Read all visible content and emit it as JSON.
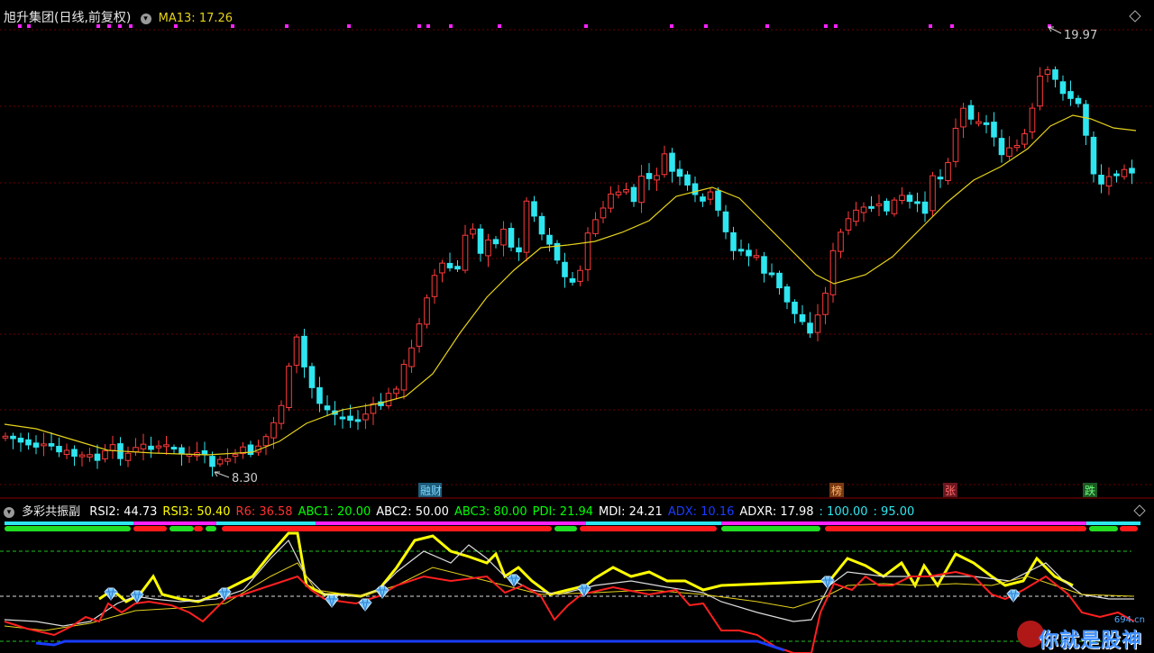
{
  "main_panel": {
    "title": "旭升集团(日线,前复权)",
    "ma_label": "MA13: 17.26",
    "high_label": "19.97",
    "low_label": "8.30",
    "events": [
      {
        "text": "融财",
        "bg": "#1d5c7a",
        "fg": "#7fd8ff"
      },
      {
        "text": "榜",
        "bg": "#7a3a12",
        "fg": "#ffb26a"
      },
      {
        "text": "张",
        "bg": "#6a1820",
        "fg": "#ff6a6a"
      },
      {
        "text": "跌",
        "bg": "#1c5a24",
        "fg": "#6aff7a"
      }
    ],
    "colors": {
      "up": "#ff3b3b",
      "down": "#2ee6f0",
      "ma": "#e6d21b",
      "dot": "#ff22ff",
      "grid": "#7a0000"
    }
  },
  "sub_panel": {
    "title": "多彩共振副",
    "indicators": [
      {
        "text": "RSI2: 44.73",
        "color": "#ffffff"
      },
      {
        "text": "RSI3: 50.40",
        "color": "#ffff00"
      },
      {
        "text": "R6: 36.58",
        "color": "#ff3030"
      },
      {
        "text": "ABC1: 20.00",
        "color": "#00ff00"
      },
      {
        "text": "ABC2: 50.00",
        "color": "#ffffff"
      },
      {
        "text": "ABC3: 80.00",
        "color": "#00ff00"
      },
      {
        "text": "PDI: 21.94",
        "color": "#00ff00"
      },
      {
        "text": "MDI: 24.21",
        "color": "#ffffff"
      },
      {
        "text": "ADX: 10.16",
        "color": "#1a3cff"
      },
      {
        "text": "ADXR: 17.98",
        "color": "#ffffff"
      },
      {
        "text": ": 100.00",
        "color": "#2ee6f0"
      },
      {
        "text": ": 95.00",
        "color": "#2ee6f0"
      }
    ]
  },
  "watermark": {
    "text": "你就是股神",
    "domain": "694.cn"
  },
  "icons": [
    "gear-icon",
    "settings-diamond-icon",
    "diamond-marker-icon"
  ]
}
